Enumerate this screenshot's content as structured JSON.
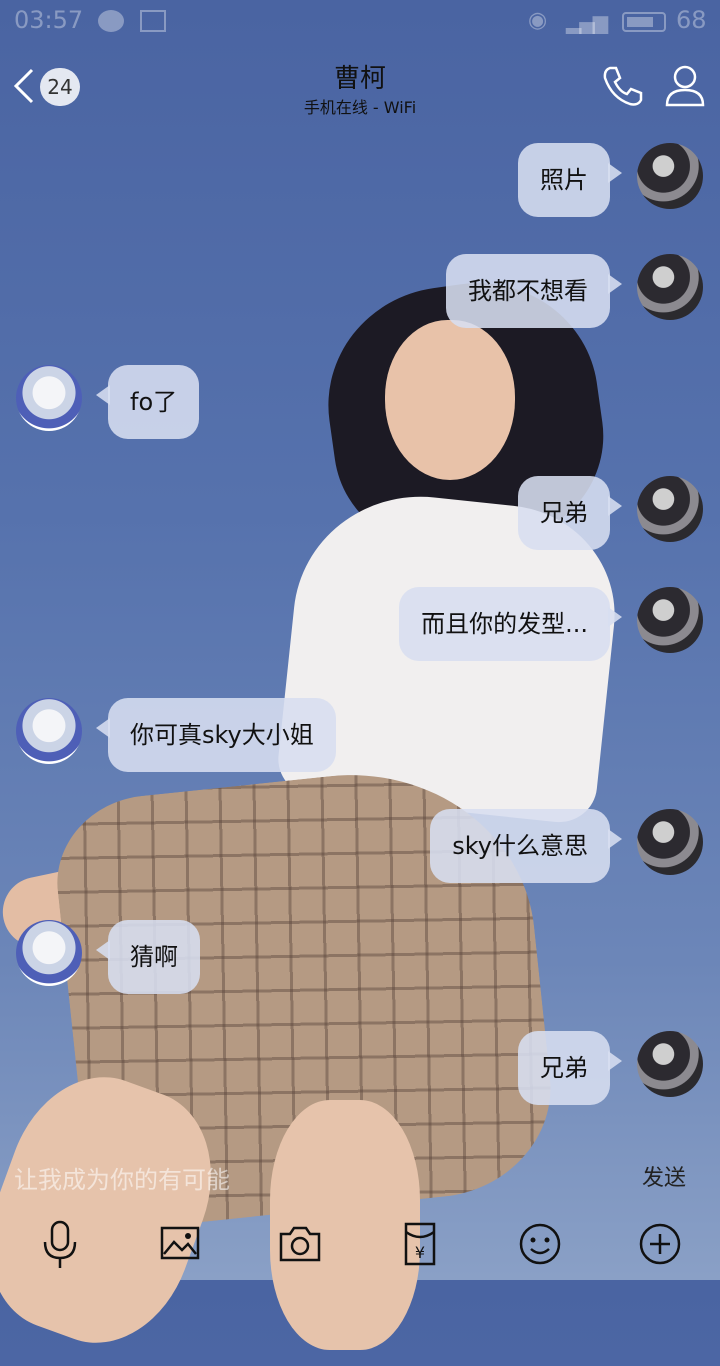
{
  "status_bar": {
    "time": "03:57",
    "battery": "68"
  },
  "header": {
    "unread_count": "24",
    "title": "曹柯",
    "subtitle": "手机在线 - WiFi"
  },
  "messages": [
    {
      "side": "me",
      "text": "照片"
    },
    {
      "side": "me",
      "text": "我都不想看"
    },
    {
      "side": "them",
      "text": "fo了"
    },
    {
      "side": "me",
      "text": "兄弟"
    },
    {
      "side": "me",
      "text": "而且你的发型..."
    },
    {
      "side": "them",
      "text": "你可真sky大小姐"
    },
    {
      "side": "me",
      "text": "sky什么意思"
    },
    {
      "side": "them",
      "text": "猜啊"
    },
    {
      "side": "me",
      "text": "兄弟"
    }
  ],
  "input": {
    "text": "让我成为你的有可能",
    "send_label": "发送"
  },
  "toolbar": [
    "mic-icon",
    "image-icon",
    "camera-icon",
    "red-packet-icon",
    "emoji-icon",
    "plus-icon"
  ]
}
